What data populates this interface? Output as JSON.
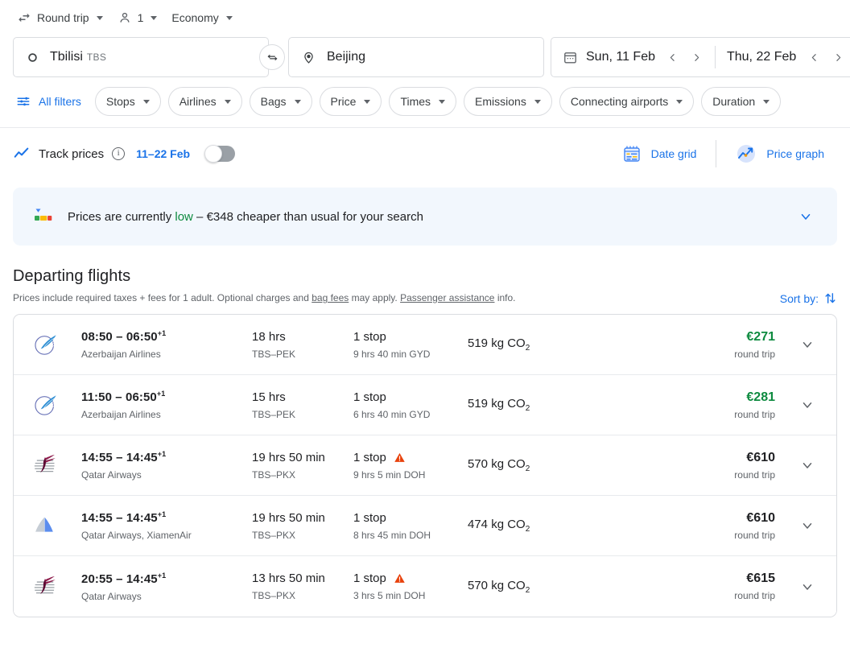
{
  "options_bar": {
    "trip_type": {
      "label": "Round trip",
      "icon": "swap-horiz-icon"
    },
    "passengers": {
      "label": "1",
      "icon": "person-icon"
    },
    "cabin_class": {
      "label": "Economy"
    }
  },
  "search": {
    "origin": {
      "city": "Tbilisi",
      "code": "TBS",
      "icon": "circle-outline-icon"
    },
    "destination": {
      "city": "Beijing",
      "code": "",
      "icon": "map-pin-icon"
    },
    "swap_icon": "swap-arrows-icon",
    "departure_date": "Sun, 11 Feb",
    "return_date": "Thu, 22 Feb",
    "calendar_icon": "calendar-icon"
  },
  "filters": {
    "all_filters_label": "All filters",
    "chips": [
      "Stops",
      "Airlines",
      "Bags",
      "Price",
      "Times",
      "Emissions",
      "Connecting airports",
      "Duration"
    ]
  },
  "track_prices": {
    "label": "Track prices",
    "info_glyph": "i",
    "date_range": "11–22 Feb",
    "toggle_state": "off",
    "date_grid_label": "Date grid",
    "price_graph_label": "Price graph"
  },
  "insight_banner": {
    "prefix": "Prices are currently ",
    "highlight": "low",
    "suffix": " – €348 cheaper than usual for your search",
    "expand_icon": "chevron-down-icon",
    "accent_color": "#0d8a3f",
    "background_color": "#f2f7fd"
  },
  "departing": {
    "title": "Departing flights",
    "disclaimer_part1": "Prices include required taxes + fees for 1 adult. Optional charges and ",
    "disclaimer_link1": "bag fees",
    "disclaimer_part2": " may apply. ",
    "disclaimer_link2": "Passenger assistance",
    "disclaimer_part3": " info.",
    "sort_by_label": "Sort by:",
    "sort_icon": "sort-arrows-icon"
  },
  "flights": [
    {
      "logo": "azerbaijan-airlines-logo",
      "times": "08:50 – 06:50",
      "day_offset": "+1",
      "airline": "Azerbaijan Airlines",
      "duration": "18 hrs",
      "route": "TBS–PEK",
      "stops": "1 stop",
      "warning": false,
      "layover": "9 hrs 40 min GYD",
      "co2_value": "519 kg CO",
      "co2_sub": "2",
      "price": "€271",
      "price_note": "round trip",
      "price_is_cheap": true
    },
    {
      "logo": "azerbaijan-airlines-logo",
      "times": "11:50 – 06:50",
      "day_offset": "+1",
      "airline": "Azerbaijan Airlines",
      "duration": "15 hrs",
      "route": "TBS–PEK",
      "stops": "1 stop",
      "warning": false,
      "layover": "6 hrs 40 min GYD",
      "co2_value": "519 kg CO",
      "co2_sub": "2",
      "price": "€281",
      "price_note": "round trip",
      "price_is_cheap": true
    },
    {
      "logo": "qatar-airways-logo",
      "times": "14:55 – 14:45",
      "day_offset": "+1",
      "airline": "Qatar Airways",
      "duration": "19 hrs 50 min",
      "route": "TBS–PKX",
      "stops": "1 stop",
      "warning": true,
      "layover": "9 hrs 5 min DOH",
      "co2_value": "570 kg CO",
      "co2_sub": "2",
      "price": "€610",
      "price_note": "round trip",
      "price_is_cheap": false
    },
    {
      "logo": "multi-airline-tail-logo",
      "times": "14:55 – 14:45",
      "day_offset": "+1",
      "airline": "Qatar Airways, XiamenAir",
      "duration": "19 hrs 50 min",
      "route": "TBS–PKX",
      "stops": "1 stop",
      "warning": false,
      "layover": "8 hrs 45 min DOH",
      "co2_value": "474 kg CO",
      "co2_sub": "2",
      "price": "€610",
      "price_note": "round trip",
      "price_is_cheap": false
    },
    {
      "logo": "qatar-airways-logo",
      "times": "20:55 – 14:45",
      "day_offset": "+1",
      "airline": "Qatar Airways",
      "duration": "13 hrs 50 min",
      "route": "TBS–PKX",
      "stops": "1 stop",
      "warning": true,
      "layover": "3 hrs 5 min DOH",
      "co2_value": "570 kg CO",
      "co2_sub": "2",
      "price": "€615",
      "price_note": "round trip",
      "price_is_cheap": false
    }
  ]
}
